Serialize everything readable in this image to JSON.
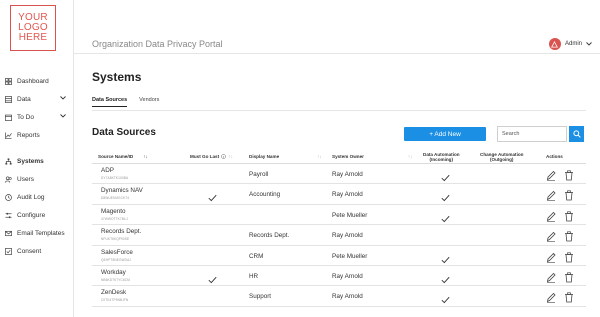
{
  "logo": {
    "line1": "YOUR",
    "line2": "LOGO",
    "line3": "HERE"
  },
  "app_title": "Organization Data Privacy Portal",
  "user": {
    "name": "Admin"
  },
  "sidebar": {
    "items": [
      {
        "label": "Dashboard",
        "icon": "grid-icon"
      },
      {
        "label": "Data",
        "icon": "database-icon"
      },
      {
        "label": "To Do",
        "icon": "calendar-icon"
      },
      {
        "label": "Reports",
        "icon": "chart-icon"
      },
      {
        "label": "Systems",
        "icon": "network-icon"
      },
      {
        "label": "Users",
        "icon": "users-icon"
      },
      {
        "label": "Audit Log",
        "icon": "log-icon"
      },
      {
        "label": "Configure",
        "icon": "sliders-icon"
      },
      {
        "label": "Email Templates",
        "icon": "mail-icon"
      },
      {
        "label": "Consent",
        "icon": "checkbox-icon"
      }
    ]
  },
  "page_title": "Systems",
  "tabs": [
    {
      "label": "Data Sources"
    },
    {
      "label": "Vendors"
    }
  ],
  "section_title": "Data Sources",
  "add_button": "+ Add New",
  "search": {
    "placeholder": "Search"
  },
  "table": {
    "headers": {
      "source": "Source Name/ID",
      "must_go_last": "Must Go Last",
      "display": "Display Name",
      "owner": "System Owner",
      "auto_in_1": "Data Automation",
      "auto_in_2": "(Incoming)",
      "auto_out_1": "Change Automation",
      "auto_out_2": "(Outgoing)",
      "actions": "Actions"
    },
    "rows": [
      {
        "name": "ADP",
        "id": "DY7A8KTK100BA",
        "display": "Payroll",
        "owner": "Ray Arnold",
        "must_last": false,
        "auto_in": true,
        "auto_out": false
      },
      {
        "name": "Dynamics NAV",
        "id": "D8WUEKMGCKT4",
        "display": "Accounting",
        "owner": "Ray Arnold",
        "must_last": true,
        "auto_in": true,
        "auto_out": false
      },
      {
        "name": "Magento",
        "id": "47WWOTTK7MLJ",
        "display": "",
        "owner": "Pete Mueller",
        "must_last": false,
        "auto_in": true,
        "auto_out": false
      },
      {
        "name": "Records Dept.",
        "id": "NFUKT6KQP90SE",
        "display": "Records Dept.",
        "owner": "Ray Arnold",
        "must_last": false,
        "auto_in": false,
        "auto_out": false
      },
      {
        "name": "SalesForce",
        "id": "QEHPT8NEGWDAJ",
        "display": "CRM",
        "owner": "Pete Mueller",
        "must_last": false,
        "auto_in": true,
        "auto_out": false
      },
      {
        "name": "Workday",
        "id": "NB6KDTK7YC6CM",
        "display": "HR",
        "owner": "Ray Arnold",
        "must_last": true,
        "auto_in": true,
        "auto_out": false
      },
      {
        "name": "ZenDesk",
        "id": "C0TK4TP9NBJFN",
        "display": "Support",
        "owner": "Ray Arnold",
        "must_last": false,
        "auto_in": true,
        "auto_out": false
      }
    ]
  },
  "colors": {
    "accent": "#1a8fe3",
    "brand": "#d9534f"
  }
}
